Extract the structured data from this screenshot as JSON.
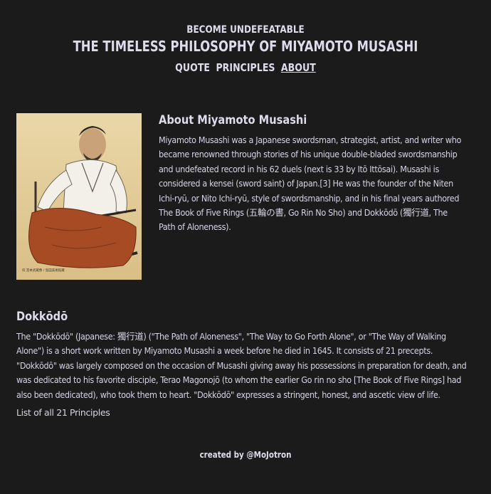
{
  "header": {
    "tagline": "BECOME UNDEFEATABLE",
    "title": "THE TIMELESS PHILOSOPHY OF MIYAMOTO MUSASHI",
    "nav": [
      {
        "label": "QUOTE"
      },
      {
        "label": "PRINCIPLES"
      },
      {
        "label": "ABOUT"
      }
    ]
  },
  "about": {
    "heading": "About Miyamoto Musashi",
    "body": "Miyamoto Musashi was a Japanese swordsman, strategist, artist, and writer who became renowned through stories of his unique double-bladed swordsmanship and undefeated record in his 62 duels (next is 33 by Itō Ittōsai). Musashi is considered a kensei (sword saint) of Japan.[3] He was the founder of the Niten Ichi-ryū, or Nito Ichi-ryū, style of swordsmanship, and in his final years authored The Book of Five Rings (五輪の書, Go Rin No Sho) and Dokkōdō (獨行道, The Path of Aloneness).",
    "portrait_caption": "伝 宮本武蔵像 / 島田美術館蔵"
  },
  "dokkodo": {
    "heading": "Dokkōdō",
    "body": "The \"Dokkōdō\" (Japanese: 獨行道) (\"The Path of Aloneness\", \"The Way to Go Forth Alone\", or \"The Way of Walking Alone\") is a short work written by Miyamoto Musashi a week before he died in 1645. It consists of 21 precepts. \"Dokkōdō\" was largely composed on the occasion of Musashi giving away his possessions in preparation for death, and was dedicated to his favorite disciple, Terao Magonojō (to whom the earlier Go rin no sho [The Book of Five Rings] had also been dedicated), who took them to heart. \"Dokkōdō\" expresses a stringent, honest, and ascetic view of life.",
    "list_link": "List of all 21 Principles"
  },
  "footer": {
    "credit": "created by @MoJotron"
  }
}
